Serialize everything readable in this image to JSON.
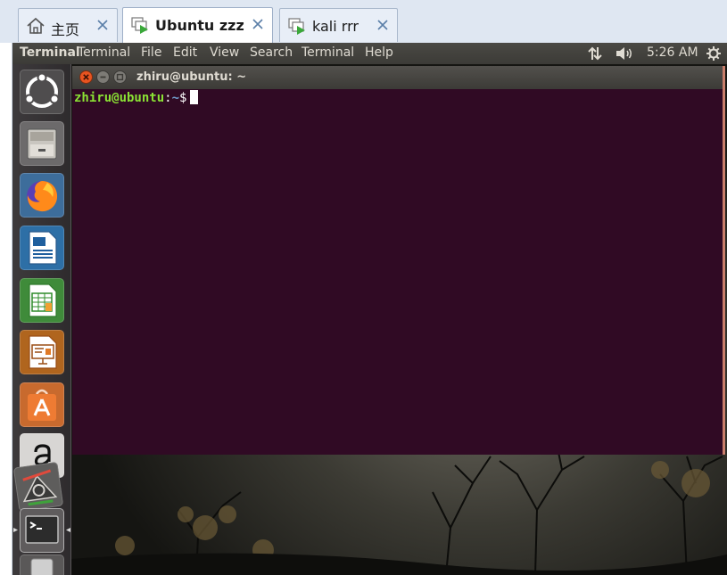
{
  "host_tabs": [
    {
      "label": "主页",
      "icon": "home-icon",
      "active": false
    },
    {
      "label": "Ubuntu zzz",
      "icon": "vm-icon",
      "active": true
    },
    {
      "label": "kali rrr",
      "icon": "vm-icon",
      "active": false
    }
  ],
  "top_panel": {
    "app_name": "Terminal",
    "menu": [
      "Terminal",
      "File",
      "Edit",
      "View",
      "Search",
      "Terminal",
      "Help"
    ],
    "clock": "5:26 AM",
    "indicators": [
      "network-arrows-icon",
      "volume-icon",
      "gear-icon"
    ]
  },
  "launcher": {
    "items": [
      {
        "name": "dash-home",
        "icon": "ubuntu-logo-icon"
      },
      {
        "name": "files",
        "icon": "file-cabinet-icon"
      },
      {
        "name": "firefox",
        "icon": "firefox-icon"
      },
      {
        "name": "libreoffice-writer",
        "icon": "writer-document-icon"
      },
      {
        "name": "libreoffice-calc",
        "icon": "calc-spreadsheet-icon"
      },
      {
        "name": "libreoffice-impress",
        "icon": "impress-presentation-icon"
      },
      {
        "name": "ubuntu-software",
        "icon": "software-center-icon"
      },
      {
        "name": "amazon",
        "icon": "amazon-icon"
      },
      {
        "name": "system-settings",
        "icon": "settings-icon"
      },
      {
        "name": "terminal",
        "icon": "terminal-icon"
      },
      {
        "name": "trash",
        "icon": "trash-icon"
      }
    ]
  },
  "terminal": {
    "title": "zhiru@ubuntu: ~",
    "prompt": {
      "user_host": "zhiru@ubuntu",
      "separator": ":",
      "path": "~",
      "symbol": "$"
    }
  },
  "colors": {
    "terminal_bg": "#300a24",
    "prompt_user": "#8ae234",
    "prompt_path": "#729fcf",
    "panel_bg": "#3c3b37",
    "close_button": "#e95420"
  }
}
